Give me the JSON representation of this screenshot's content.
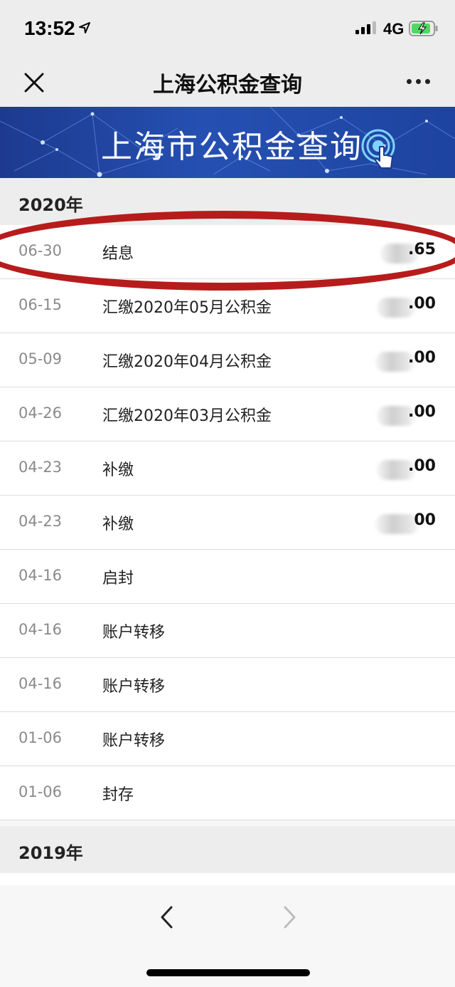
{
  "status_bar": {
    "time": "13:52",
    "network": "4G"
  },
  "nav": {
    "title": "上海公积金查询",
    "close_icon": "close-icon",
    "more_icon": "more-icon"
  },
  "banner": {
    "title": "上海市公积金查询",
    "icon": "touch-icon"
  },
  "sections": [
    {
      "year": "2020年",
      "rows": [
        {
          "date": "06-30",
          "desc": "结息",
          "amount": ".65"
        },
        {
          "date": "06-15",
          "desc": "汇缴2020年05月公积金",
          "amount": ".00"
        },
        {
          "date": "05-09",
          "desc": "汇缴2020年04月公积金",
          "amount": ".00"
        },
        {
          "date": "04-26",
          "desc": "汇缴2020年03月公积金",
          "amount": ".00"
        },
        {
          "date": "04-23",
          "desc": "补缴",
          "amount": ".00"
        },
        {
          "date": "04-23",
          "desc": "补缴",
          "amount": "00"
        },
        {
          "date": "04-16",
          "desc": "启封",
          "amount": ""
        },
        {
          "date": "04-16",
          "desc": "账户转移",
          "amount": ""
        },
        {
          "date": "04-16",
          "desc": "账户转移",
          "amount": ""
        },
        {
          "date": "01-06",
          "desc": "账户转移",
          "amount": ""
        },
        {
          "date": "01-06",
          "desc": "封存",
          "amount": ""
        }
      ]
    },
    {
      "year": "2019年",
      "rows": []
    }
  ],
  "colors": {
    "banner": "#2550b2",
    "highlight": "#b71c1c"
  },
  "toolbar": {
    "back_icon": "chevron-left-icon",
    "forward_icon": "chevron-right-icon"
  }
}
